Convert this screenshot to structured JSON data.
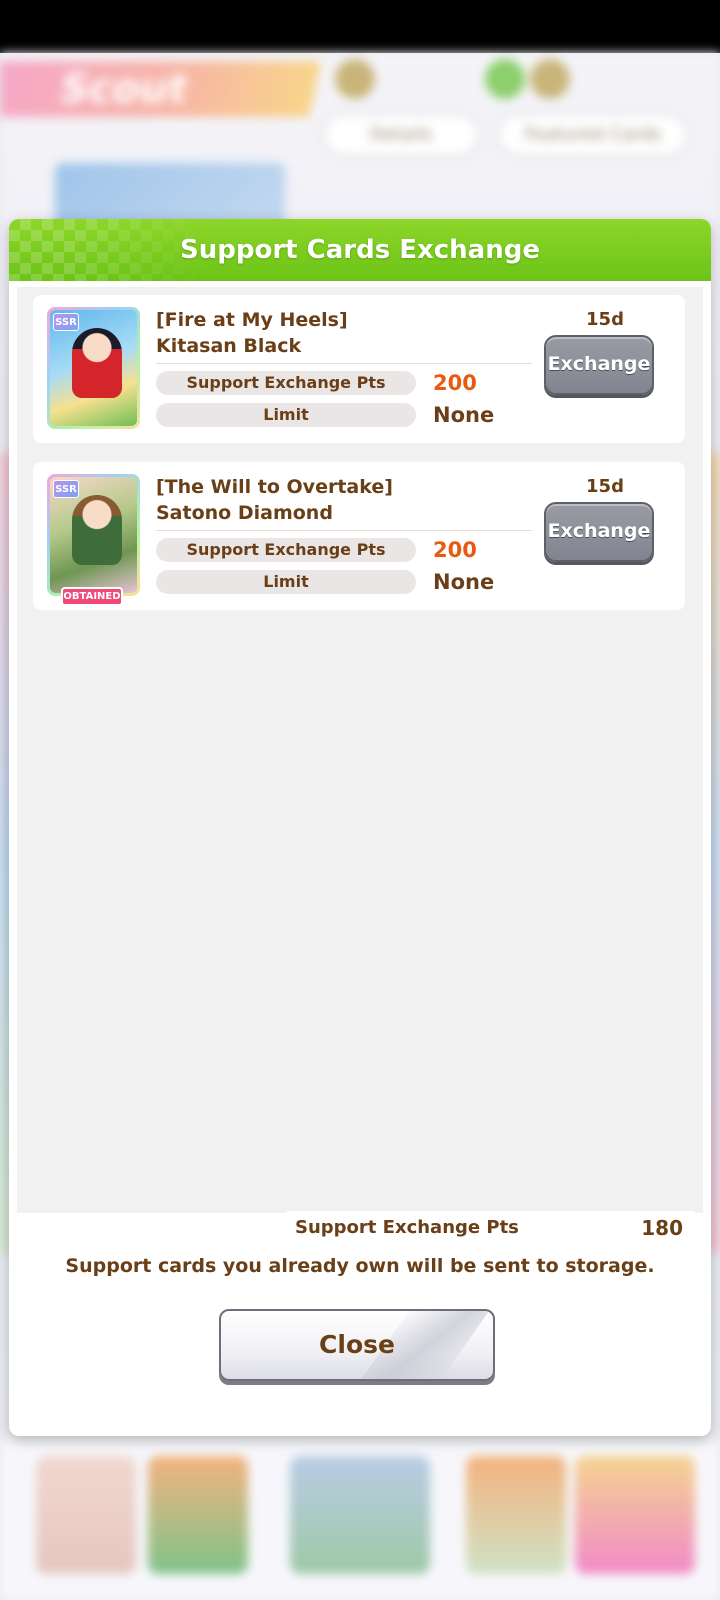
{
  "background": {
    "screen_title": "Scout",
    "pill_buttons": [
      "Details",
      "Featured Cards"
    ]
  },
  "dialog": {
    "title": "Support Cards Exchange",
    "accent_color": "#6cc417",
    "cards": [
      {
        "rarity": "SSR",
        "title_line1": "[Fire at My Heels]",
        "title_line2": "Kitasan Black",
        "pts_label": "Support Exchange Pts",
        "pts_value": "200",
        "limit_label": "Limit",
        "limit_value": "None",
        "days_left": "15d",
        "exchange_label": "Exchange",
        "obtained": false
      },
      {
        "rarity": "SSR",
        "title_line1": "[The Will to Overtake]",
        "title_line2": "Satono Diamond",
        "pts_label": "Support Exchange Pts",
        "pts_value": "200",
        "limit_label": "Limit",
        "limit_value": "None",
        "days_left": "15d",
        "exchange_label": "Exchange",
        "obtained": true,
        "obtained_label": "OBTAINED"
      }
    ],
    "balance": {
      "label": "Support Exchange Pts",
      "value": "180"
    },
    "storage_note": "Support cards you already own will be sent to storage.",
    "close_label": "Close"
  },
  "colors": {
    "text_brown": "#6a3f17",
    "cost_orange": "#e85a10",
    "obtained_pink": "#f04a79",
    "exchange_gray": "#818390"
  }
}
